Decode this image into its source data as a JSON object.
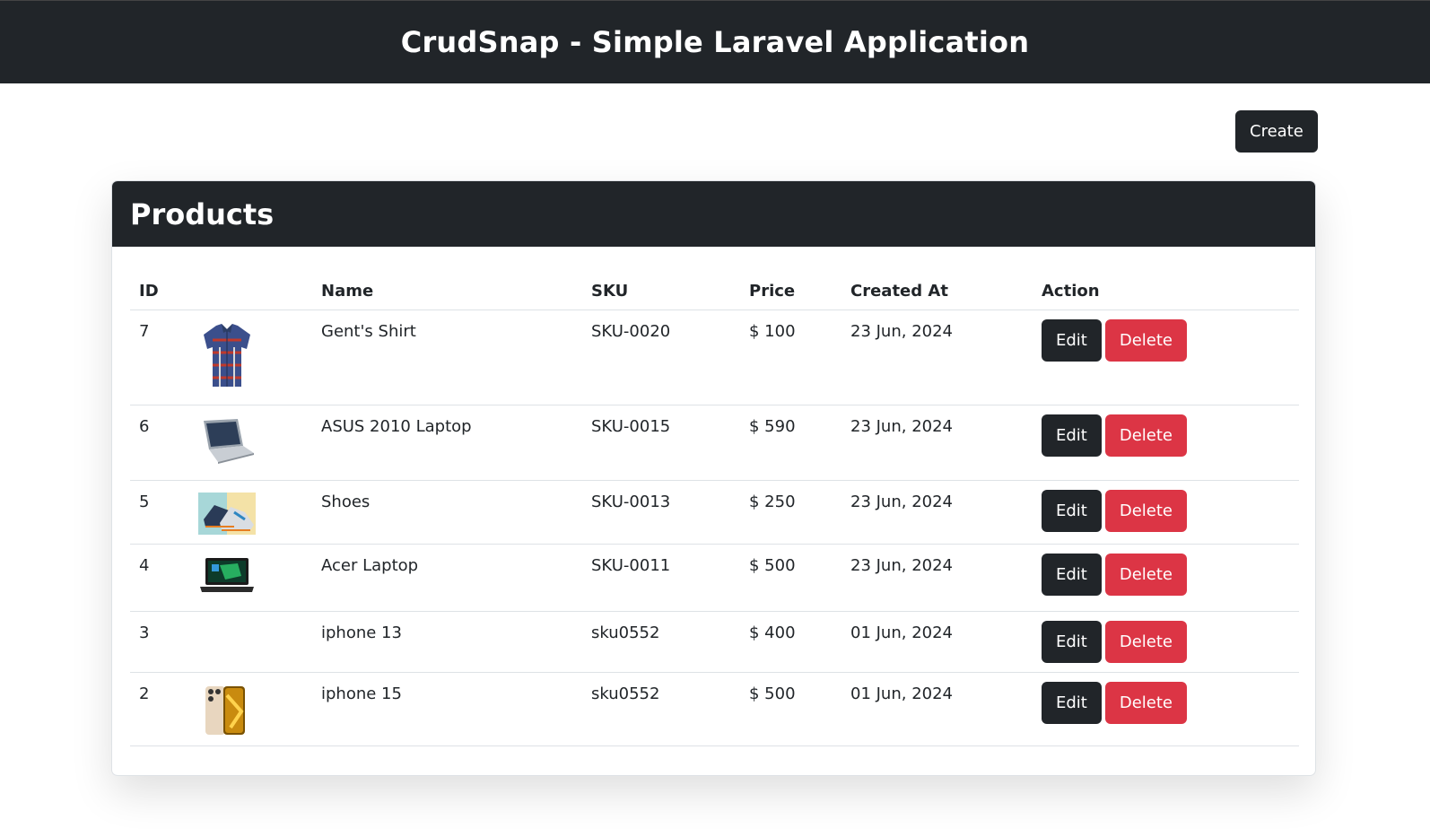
{
  "header": {
    "title": "CrudSnap - Simple Laravel Application"
  },
  "toolbar": {
    "create_label": "Create"
  },
  "card": {
    "title": "Products"
  },
  "table": {
    "columns": [
      "ID",
      "",
      "Name",
      "SKU",
      "Price",
      "Created At",
      "Action"
    ],
    "rows": [
      {
        "id": "7",
        "image": "shirt-image",
        "name": "Gent's Shirt",
        "sku": "SKU-0020",
        "price": "$ 100",
        "created": "23 Jun, 2024",
        "edit": "Edit",
        "delete": "Delete"
      },
      {
        "id": "6",
        "image": "laptop-silver-image",
        "name": "ASUS 2010 Laptop",
        "sku": "SKU-0015",
        "price": "$ 590",
        "created": "23 Jun, 2024",
        "edit": "Edit",
        "delete": "Delete"
      },
      {
        "id": "5",
        "image": "shoes-image",
        "name": "Shoes",
        "sku": "SKU-0013",
        "price": "$ 250",
        "created": "23 Jun, 2024",
        "edit": "Edit",
        "delete": "Delete"
      },
      {
        "id": "4",
        "image": "laptop-black-image",
        "name": "Acer Laptop",
        "sku": "SKU-0011",
        "price": "$ 500",
        "created": "23 Jun, 2024",
        "edit": "Edit",
        "delete": "Delete"
      },
      {
        "id": "3",
        "image": "",
        "name": "iphone 13",
        "sku": "sku0552",
        "price": "$ 400",
        "created": "01 Jun, 2024",
        "edit": "Edit",
        "delete": "Delete"
      },
      {
        "id": "2",
        "image": "iphone-image",
        "name": "iphone 15",
        "sku": "sku0552",
        "price": "$ 500",
        "created": "01 Jun, 2024",
        "edit": "Edit",
        "delete": "Delete"
      }
    ]
  },
  "colors": {
    "dark": "#212529",
    "danger": "#dc3545"
  }
}
